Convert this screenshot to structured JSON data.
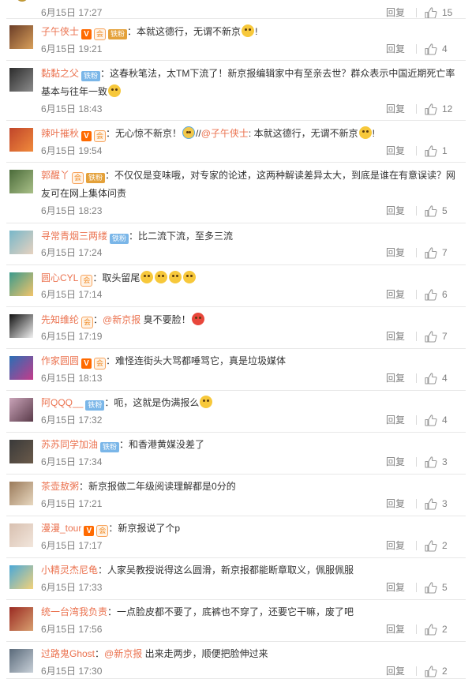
{
  "comments": [
    {
      "user": "",
      "badges": [],
      "text": [],
      "time": "6月15日 17:27",
      "reply": "回复",
      "likes": "15",
      "avatar": [
        "#e6b93a",
        "#7a5a22"
      ]
    },
    {
      "user": "子午侠士",
      "badges": [
        "v",
        "vip-iron"
      ],
      "text": [
        {
          "t": "：本就这德行，无谓不新京"
        },
        {
          "e": "cry"
        },
        {
          "t": "!"
        }
      ],
      "time": "6月15日 19:21",
      "reply": "回复",
      "likes": "4",
      "avatar": [
        "#6b3d27",
        "#d9a05b"
      ]
    },
    {
      "user": "黏黏之父",
      "badges": [
        "fan"
      ],
      "text": [
        {
          "t": "：这春秋笔法，太TM下流了！新京报编辑家中有至亲去世？群众表示中国近期死亡率基本与往年一致"
        },
        {
          "e": "doge"
        }
      ],
      "time": "6月15日 18:43",
      "reply": "回复",
      "likes": "12",
      "avatar": [
        "#2c2c2c",
        "#8c8c8c"
      ]
    },
    {
      "user": "辣叶摧秋",
      "badges": [
        "v",
        "vip"
      ],
      "text": [
        {
          "t": "：无心惊不新京！"
        },
        {
          "e": "hug"
        },
        {
          "t": "//"
        },
        {
          "m": "@子午侠士"
        },
        {
          "t": ": 本就这德行，无谓不新京"
        },
        {
          "e": "cry"
        },
        {
          "t": "!"
        }
      ],
      "time": "6月15日 19:54",
      "reply": "回复",
      "likes": "1",
      "avatar": [
        "#c0452a",
        "#f08a3c"
      ]
    },
    {
      "user": "郭醒丫",
      "badges": [
        "vip-iron"
      ],
      "text": [
        {
          "t": "：不仅仅是变味哦，对专家的论述，这两种解读差异太大，到底是谁在有意误读？网友可在网上集体问责"
        }
      ],
      "time": "6月15日 18:23",
      "reply": "回复",
      "likes": "5",
      "avatar": [
        "#4b6b3a",
        "#a9c088"
      ]
    },
    {
      "user": "寻常青烟三两缕",
      "badges": [
        "fan"
      ],
      "text": [
        {
          "t": "：比二流下流，至多三流"
        }
      ],
      "time": "6月15日 17:24",
      "reply": "回复",
      "likes": "7",
      "avatar": [
        "#78b7c9",
        "#e7d2c0"
      ]
    },
    {
      "user": "圆心CYL",
      "badges": [
        "vip"
      ],
      "text": [
        {
          "t": "：取头留尾"
        },
        {
          "e": "smile"
        },
        {
          "e": "smile"
        },
        {
          "e": "smile"
        },
        {
          "e": "smile"
        }
      ],
      "time": "6月15日 17:14",
      "reply": "回复",
      "likes": "6",
      "avatar": [
        "#3b9a8c",
        "#f2c46a"
      ]
    },
    {
      "user": "先知维纶",
      "badges": [
        "vip"
      ],
      "text": [
        {
          "t": "："
        },
        {
          "m": "@新京报"
        },
        {
          "t": " 臭不要脸！"
        },
        {
          "e": "angry"
        }
      ],
      "time": "6月15日 17:19",
      "reply": "回复",
      "likes": "7",
      "avatar": [
        "#111111",
        "#f2f2f2"
      ]
    },
    {
      "user": "作家圆圆",
      "badges": [
        "v",
        "vip"
      ],
      "text": [
        {
          "t": "：难怪连街头大骂都唾骂它，真是垃圾媒体"
        }
      ],
      "time": "6月15日 18:13",
      "reply": "回复",
      "likes": "4",
      "avatar": [
        "#2a6fb5",
        "#c43b8a"
      ]
    },
    {
      "user": "阿QQQ__",
      "badges": [
        "fan"
      ],
      "text": [
        {
          "t": "：呃，这就是伪满报么"
        },
        {
          "e": "think"
        }
      ],
      "time": "6月15日 17:32",
      "reply": "回复",
      "likes": "4",
      "avatar": [
        "#c9a3b8",
        "#5a3b4a"
      ]
    },
    {
      "user": "苏苏同学加油",
      "badges": [
        "fan"
      ],
      "text": [
        {
          "t": "：和香港黄媒没差了"
        }
      ],
      "time": "6月15日 17:34",
      "reply": "回复",
      "likes": "3",
      "avatar": [
        "#3a3a3a",
        "#6a5a4a"
      ]
    },
    {
      "user": "茶壶敖粥",
      "badges": [],
      "text": [
        {
          "t": "：新京报做二年级阅读理解都是0分的"
        }
      ],
      "time": "6月15日 17:21",
      "reply": "回复",
      "likes": "3",
      "avatar": [
        "#9a7a5a",
        "#e8d8c0"
      ]
    },
    {
      "user": "漫漫_tour",
      "badges": [
        "v",
        "vip"
      ],
      "text": [
        {
          "t": "：新京报说了个p"
        }
      ],
      "time": "6月15日 17:17",
      "reply": "回复",
      "likes": "2",
      "avatar": [
        "#d8c0b0",
        "#f2e6dc"
      ]
    },
    {
      "user": "小精灵杰尼龟",
      "badges": [],
      "text": [
        {
          "t": "：人家吴教授说得这么圆滑，新京报都能断章取义，佩服佩服"
        }
      ],
      "time": "6月15日 17:33",
      "reply": "回复",
      "likes": "5",
      "avatar": [
        "#4aa8d8",
        "#f2d27a"
      ]
    },
    {
      "user": "统一台湾我负责",
      "badges": [],
      "text": [
        {
          "t": "：一点脸皮都不要了，底裤也不穿了，还要它干嘛，废了吧"
        }
      ],
      "time": "6月15日 17:56",
      "reply": "回复",
      "likes": "2",
      "avatar": [
        "#9a2a22",
        "#d8a070"
      ]
    },
    {
      "user": "过路鬼Ghost",
      "badges": [],
      "text": [
        {
          "t": "："
        },
        {
          "m": "@新京报"
        },
        {
          "t": " 出来走两步，顺便把脸伸过来"
        }
      ],
      "time": "6月15日 17:30",
      "reply": "回复",
      "likes": "2",
      "avatar": [
        "#5a6a7a",
        "#c8d0d8"
      ]
    }
  ],
  "badge_labels": {
    "v": "V",
    "vip": "会",
    "vip-iron": "铁粉",
    "fan": "铁粉"
  },
  "colors": {
    "username": "#eb7350",
    "meta": "#808080",
    "separator": "#e8e8e8"
  }
}
